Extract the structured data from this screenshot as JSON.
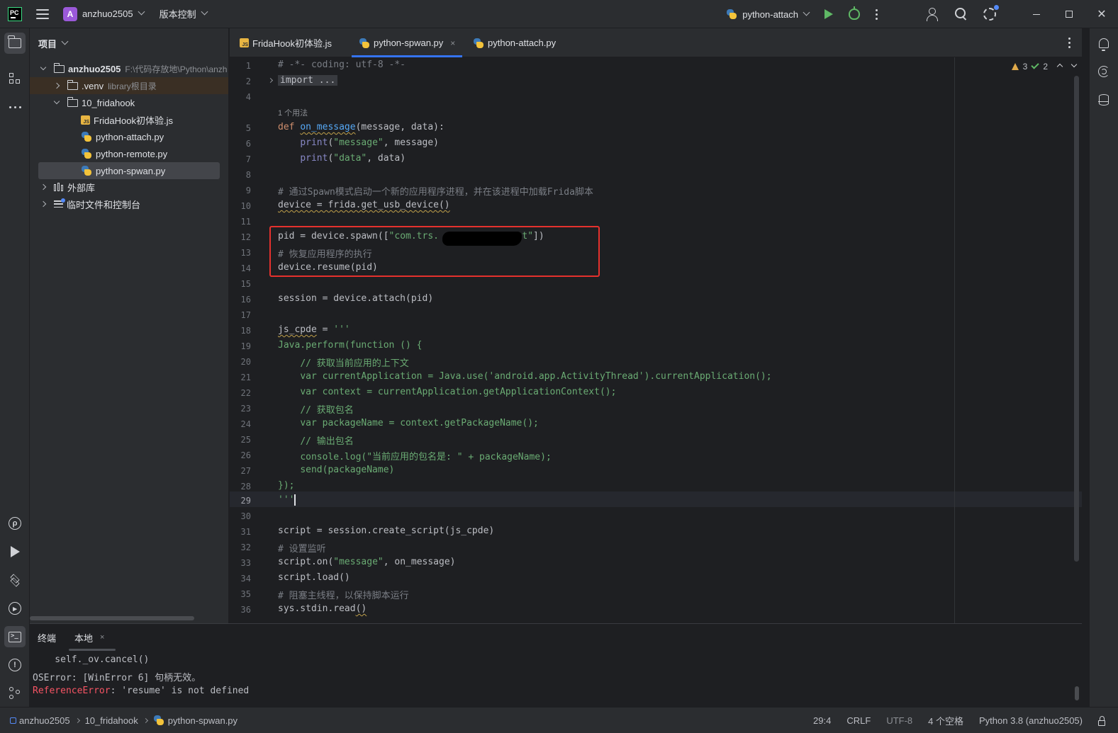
{
  "app": {
    "logo_text": "PC",
    "project_initial": "A",
    "project_name": "anzhuo2505",
    "vcs_menu": "版本控制",
    "run_config": "python-attach"
  },
  "project_panel": {
    "title": "项目",
    "tree": [
      {
        "label": "anzhuo2505",
        "meta": "F:\\代码存放地\\Python\\anzh"
      },
      {
        "label": ".venv",
        "meta": "library根目录"
      },
      {
        "label": "10_fridahook"
      },
      {
        "label": "FridaHook初体验.js"
      },
      {
        "label": "python-attach.py"
      },
      {
        "label": "python-remote.py"
      },
      {
        "label": "python-spwan.py"
      },
      {
        "label": "外部库"
      },
      {
        "label": "临时文件和控制台"
      }
    ]
  },
  "tabs": [
    {
      "label": "FridaHook初体验.js"
    },
    {
      "label": "python-spwan.py",
      "close": "×"
    },
    {
      "label": "python-attach.py"
    }
  ],
  "inspections": {
    "warnings": "3",
    "ok": "2"
  },
  "code": {
    "line_numbers": [
      "1",
      "2",
      "4",
      "5",
      "6",
      "7",
      "8",
      "9",
      "10",
      "11",
      "12",
      "13",
      "14",
      "15",
      "16",
      "17",
      "18",
      "19",
      "20",
      "21",
      "22",
      "23",
      "24",
      "25",
      "26",
      "27",
      "28",
      "29",
      "30",
      "31",
      "32",
      "33",
      "34",
      "35",
      "36"
    ],
    "usage_hint": "1 个用法",
    "l1": "# -*- coding: utf-8 -*-",
    "l2": "import ...",
    "l9": "# 通过Spawn模式启动一个新的应用程序进程，并在该进程中加载Frida脚本",
    "l12_str": "\"com.trs.          client\"",
    "l13": "# 恢复应用程序的执行",
    "l20": "// 获取当前应用的上下文",
    "l21": "var currentApplication = Java.use('android.app.ActivityThread').currentApplication();",
    "l22": "var context = currentApplication.getApplicationContext();",
    "l23": "// 获取包名",
    "l24": "var packageName = context.getPackageName();",
    "l25": "// 输出包名",
    "l26": "console.log(\"当前应用的包名是: \" + packageName);",
    "l27": "send(packageName)",
    "l32": "# 设置监听",
    "l35": "# 阻塞主线程，以保持脚本运行"
  },
  "terminal": {
    "tabs": [
      "终端",
      "本地"
    ],
    "close": "×",
    "lines": [
      "    self._ov.cancel()",
      "OSError: [WinError 6] 句柄无效。"
    ],
    "error_name": "ReferenceError",
    "error_msg": ": 'resume' is not defined"
  },
  "statusbar": {
    "breadcrumb": [
      "anzhuo2505",
      "10_fridahook",
      "python-spwan.py"
    ],
    "position": "29:4",
    "line_sep": "CRLF",
    "encoding": "UTF-8",
    "indent": "4 个空格",
    "interpreter": "Python 3.8 (anzhuo2505)"
  }
}
